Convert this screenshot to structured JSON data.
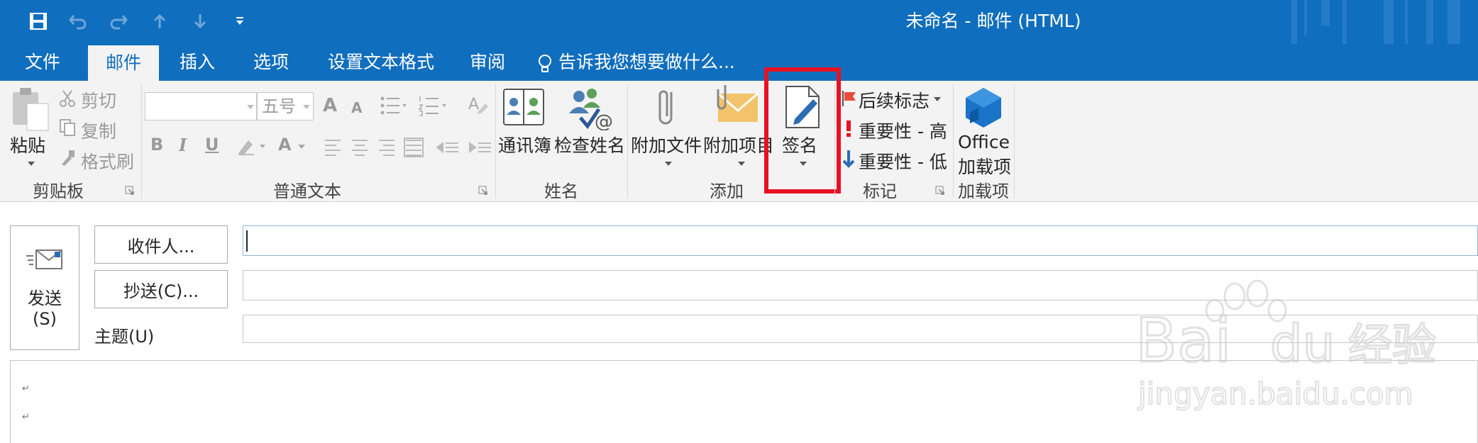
{
  "window": {
    "title": "未命名 - 邮件 (HTML)",
    "quick_access": [
      "save-icon",
      "undo-icon",
      "redo-icon",
      "up-arrow-icon",
      "down-arrow-icon",
      "customize-qat-icon"
    ]
  },
  "tabs": [
    {
      "label": "文件",
      "active": false
    },
    {
      "label": "邮件",
      "active": true
    },
    {
      "label": "插入",
      "active": false
    },
    {
      "label": "选项",
      "active": false
    },
    {
      "label": "设置文本格式",
      "active": false
    },
    {
      "label": "审阅",
      "active": false
    }
  ],
  "tell_me": {
    "text": "告诉我您想要做什么..."
  },
  "ribbon": {
    "clipboard": {
      "group_label": "剪贴板",
      "paste": "粘贴",
      "cut": "剪切",
      "copy": "复制",
      "format_painter": "格式刷"
    },
    "basic_text": {
      "group_label": "普通文本",
      "font_name": "",
      "font_size": "五号",
      "bold": "B",
      "italic": "I",
      "underline": "U",
      "font_color": "A"
    },
    "names": {
      "group_label": "姓名",
      "address_book": "通讯簿",
      "check_names": "检查姓名"
    },
    "include": {
      "group_label": "添加",
      "attach_file": "附加文件",
      "attach_item": "附加项目",
      "signature": "签名"
    },
    "tags": {
      "group_label": "标记",
      "follow_up": "后续标志",
      "high_importance": "重要性 - 高",
      "low_importance": "重要性 - 低"
    },
    "addins": {
      "group_label": "加载项",
      "office_addins_line1": "Office",
      "office_addins_line2": "加载项"
    }
  },
  "compose": {
    "send_line1": "发送",
    "send_line2": "(S)",
    "to_button": "收件人...",
    "cc_button": "抄送(C)...",
    "subject_label": "主题(U)",
    "to_value": "",
    "cc_value": "",
    "subject_value": "",
    "body_marks": [
      "↵",
      "↵"
    ]
  },
  "watermark": {
    "line1": "Bai",
    "line2": "du",
    "brand": "经验",
    "url": "jingyan.baidu.com"
  },
  "colors": {
    "titlebar": "#106ebe",
    "ribbon": "#f3f3f3",
    "highlight": "#e81123",
    "accent": "#2b579a"
  }
}
